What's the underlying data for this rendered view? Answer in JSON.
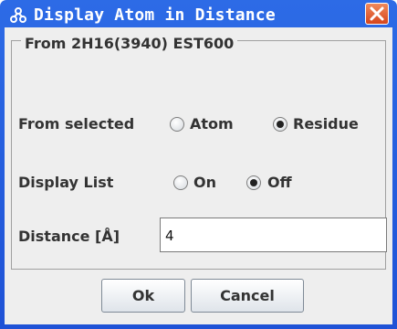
{
  "window": {
    "title": "Display Atom in Distance",
    "accent": "#2d6be6",
    "close_color": "#d6451c"
  },
  "group": {
    "legend": "From 2H16(3940) EST600"
  },
  "from_selected": {
    "label": "From selected",
    "options": [
      {
        "label": "Atom",
        "checked": false
      },
      {
        "label": "Residue",
        "checked": true
      }
    ]
  },
  "display_list": {
    "label": "Display List",
    "options": [
      {
        "label": "On",
        "checked": false
      },
      {
        "label": "Off",
        "checked": true
      }
    ]
  },
  "distance": {
    "label": "Distance [Å]",
    "value": "4"
  },
  "buttons": {
    "ok": "Ok",
    "cancel": "Cancel"
  }
}
